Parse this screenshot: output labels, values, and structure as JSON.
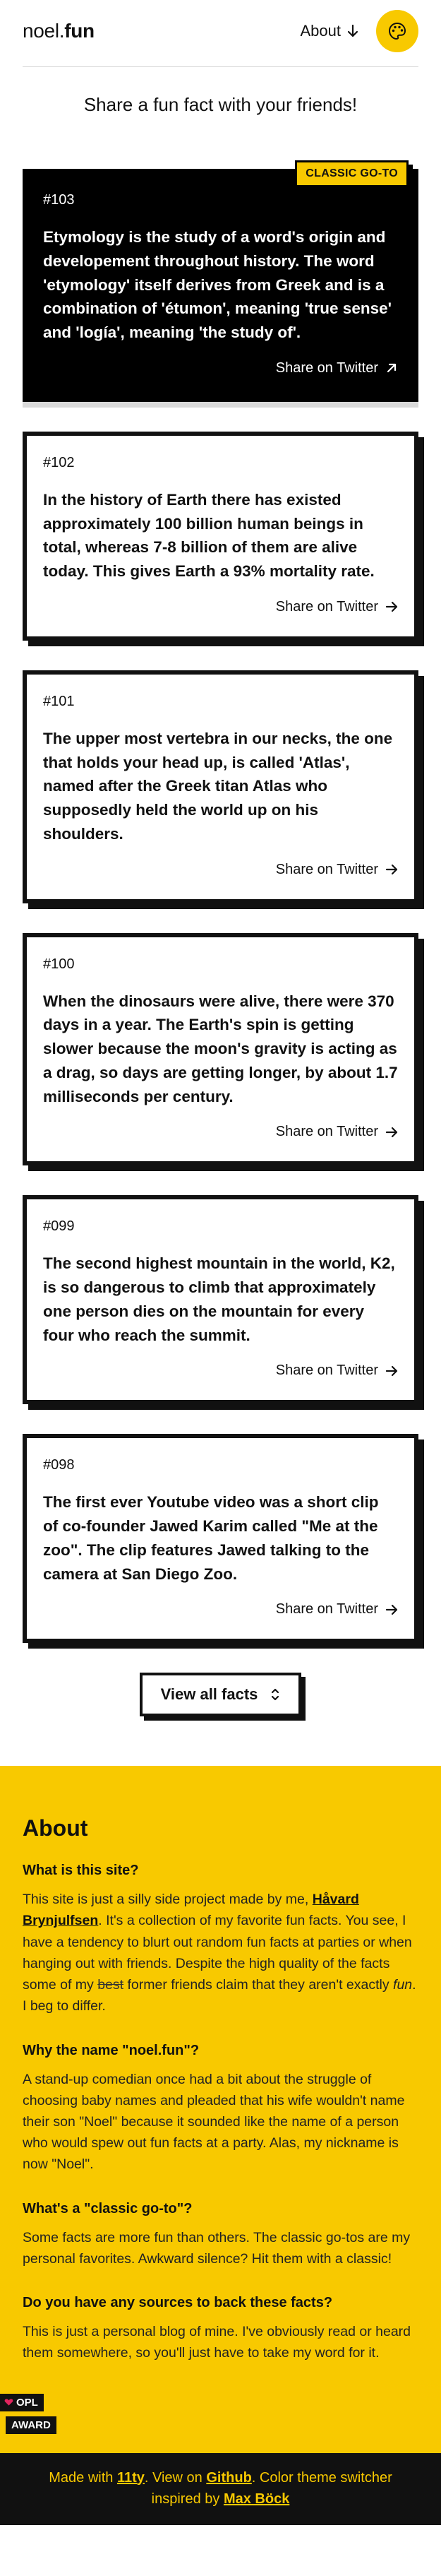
{
  "header": {
    "logo_prefix": "noel.",
    "logo_bold": "fun",
    "nav_about": "About"
  },
  "tagline": "Share a fun fact with your friends!",
  "facts": [
    {
      "num": "#103",
      "badge": "CLASSIC GO-TO",
      "text": "Etymology is the study of a word's origin and developement throughout history. The word 'etymology' itself derives from Greek and is a combination of 'étumon', meaning 'true sense' and 'logía', meaning 'the study of'.",
      "share": "Share on Twitter"
    },
    {
      "num": "#102",
      "text": "In the history of Earth there has existed approximately 100 billion human beings in total, whereas 7-8 billion of them are alive today. This gives Earth a 93% mortality rate.",
      "share": "Share on Twitter"
    },
    {
      "num": "#101",
      "text": "The upper most vertebra in our necks, the one that holds your head up, is called 'Atlas', named after the Greek titan Atlas who supposedly held the world up on his shoulders.",
      "share": "Share on Twitter"
    },
    {
      "num": "#100",
      "text": "When the dinosaurs were alive, there were 370 days in a year. The Earth's spin is getting slower because the moon's gravity is acting as a drag, so days are getting longer, by about 1.7 milliseconds per century.",
      "share": "Share on Twitter"
    },
    {
      "num": "#099",
      "text": "The second highest mountain in the world, K2, is so dangerous to climb that approximately one person dies on the mountain for every four who reach the summit.",
      "share": "Share on Twitter"
    },
    {
      "num": "#098",
      "text": "The first ever Youtube video was a short clip of co-founder Jawed Karim called \"Me at the zoo\". The clip features Jawed talking to the camera at San Diego Zoo.",
      "share": "Share on Twitter"
    }
  ],
  "view_all": "View all facts",
  "about": {
    "title": "About",
    "q1": "What is this site?",
    "a1_part1": "This site is just a silly side project made by me, ",
    "a1_link": "Håvard Brynjulfsen",
    "a1_part2": ". It's a collection of my favorite fun facts. You see, I have a tendency to blurt out random fun facts at parties or when hanging out with friends. Despite the high quality of the facts some of my ",
    "a1_strike": "best",
    "a1_part3": " former friends claim that they aren't exactly ",
    "a1_em": "fun",
    "a1_part4": ". I beg to differ.",
    "q2": "Why the name \"noel.fun\"?",
    "a2": "A stand-up comedian once had a bit about the struggle of choosing baby names and pleaded that his wife wouldn't name their son \"Noel\" because it sounded like the name of a person who would spew out fun facts at a party. Alas, my nickname is now \"Noel\".",
    "q3": "What's a \"classic go-to\"?",
    "a3": "Some facts are more fun than others. The classic go-tos are my personal favorites. Awkward silence? Hit them with a classic!",
    "q4": "Do you have any sources to back these facts?",
    "a4": "This is just a personal blog of mine. I've obviously read or heard them somewhere, so you'll just have to take my word for it."
  },
  "opl": {
    "top": "OPL",
    "bottom": "AWARD"
  },
  "footer": {
    "part1": "Made with ",
    "link1": "11ty",
    "part2": ". View on ",
    "link2": "Github",
    "part3": ". Color theme switcher inspired by ",
    "link3": "Max Böck"
  },
  "colors": {
    "accent": "#f8c900",
    "dark": "#111111"
  }
}
